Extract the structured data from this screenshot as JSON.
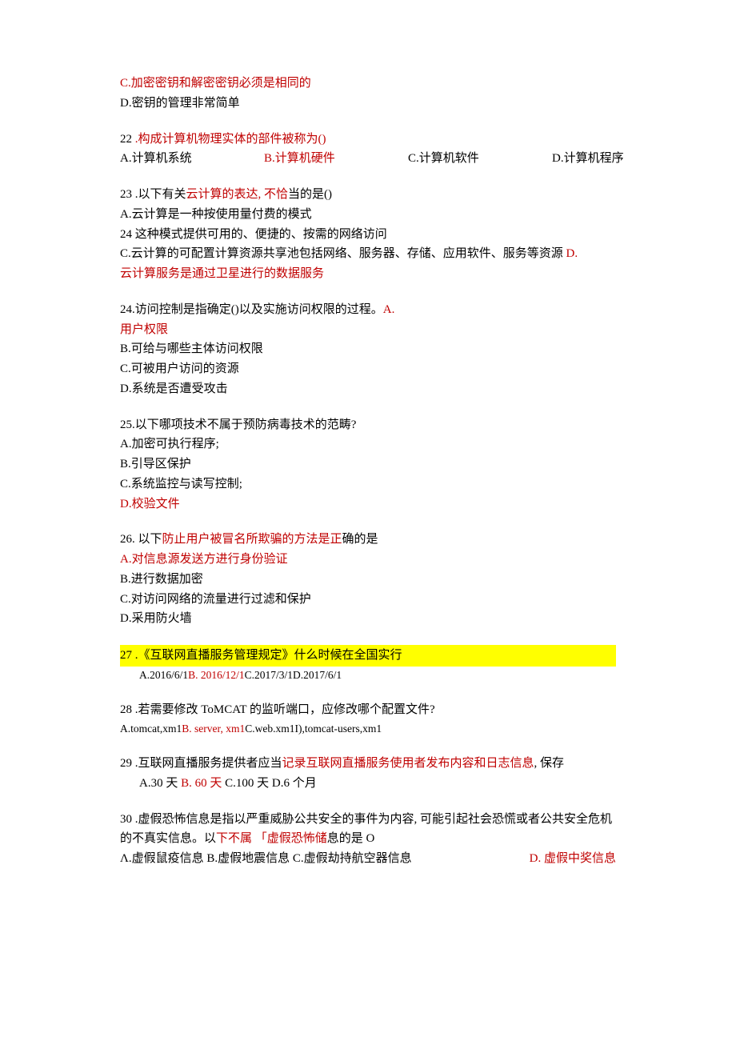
{
  "pre21": {
    "c_text": "C.加密密钥和解密密钥必须是相同的",
    "d_text": "D.密钥的管理非常简单"
  },
  "q22": {
    "num": "22",
    "stem_suffix": "  .构成计算机物理实体的部件被称为()",
    "a": "A.计算机系统",
    "b": "B.计算机硬件",
    "c": "C.计算机软件",
    "d": "D.计算机程序"
  },
  "q23": {
    "num": "23",
    "prefix": "  .以下有关",
    "mid_red": "云计算的表达, 不恰",
    "suffix": "当的是()",
    "a": "A.云计算是一种按使用量付费的模式",
    "line24": "24  这种模式提供可用的、便捷的、按需的网络访问",
    "c_text": "C.云计算的可配置计算资源共享池包括网络、服务器、存储、应用软件、服务等资源 ",
    "c_dmark": "D.",
    "d_red": "云计算服务是通过卫星进行的数据服务"
  },
  "q24": {
    "stem_pre": "24.访问控制是指确定()以及实施访问权限的过程。",
    "a_mark": "A.",
    "a_red": "用户权限",
    "b": "B.可给与哪些主体访问权限",
    "c": "C.可被用户访问的资源",
    "d": "D.系统是否遭受攻击"
  },
  "q25": {
    "stem": "25.以下哪项技术不属于预防病毒技术的范畴?",
    "a": "A.加密可执行程序;",
    "b": "B.引导区保护",
    "c": "C.系统监控与读写控制;",
    "d_red": "D.校验文件"
  },
  "q26": {
    "pre": "26. 以下",
    "mid_red": "防止用户被冒名所欺骗的方法是正",
    "suf": "确的是",
    "a_red": "A.对信息源发送方进行身份验证",
    "b": "B.进行数据加密",
    "c": "C.对访问网络的流量进行过滤和保护",
    "d": "D.采用防火墙"
  },
  "q27": {
    "hl_line": "27     .《互联网直播服务管理规定》什么时候在全国实行",
    "opt_a": "A.2016/6/1",
    "opt_b_red": "B. 2016/12/1",
    "opt_cd": "C.2017/3/1D.2017/6/1"
  },
  "q28": {
    "stem": "28    .若需要修改 ToMCAT 的监听端口，应修改哪个配置文件?",
    "opt_a": "A.tomcat,xm1",
    "opt_b_red": "B. server, xm1",
    "opt_cd": "C.web.xm1I),tomcat-users,xm1"
  },
  "q29": {
    "pre": "29    .互联网直播服务提供者应当",
    "mid_red": "记录互联网直播服务使用者发布内容和日志信息",
    "suf": ", 保存",
    "opt_a": "A.30 天 ",
    "opt_b_red": "B. 60 天",
    "opt_cd": " C.100 天 D.6 个月"
  },
  "q30": {
    "pre": "30    .虚假恐怖信息是指以严重威胁公共安全的事件为内容, 可能引起社会恐慌或者公共安全危机的不真实信息。以",
    "mid_red": "下不属 「虚假恐怖储",
    "suf": "息的是 O",
    "opt_abc": "Λ.虚假鼠疫信息 B.虚假地震信息 C.虚假劫持航空器信息",
    "opt_d_red": "D. 虚假中奖信息"
  }
}
